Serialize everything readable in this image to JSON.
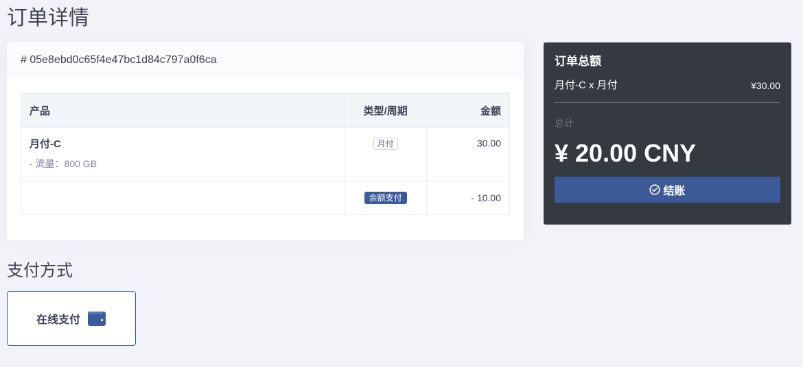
{
  "page_title": "订单详情",
  "order": {
    "id_label": "# 05e8ebd0c65f4e47bc1d84c797a0f6ca",
    "table": {
      "headers": [
        "产品",
        "类型/周期",
        "金额"
      ],
      "rows": [
        {
          "product_name": "月付-C",
          "product_detail": "- 流量：800 GB",
          "type_badge": "月付",
          "amount": "30.00"
        },
        {
          "product_name": "",
          "product_detail": "",
          "type_badge": "余额支付",
          "amount": "- 10.00"
        }
      ]
    }
  },
  "summary": {
    "title": "订单总额",
    "line_label": "月付-C x 月付",
    "line_price": "¥30.00",
    "total_label": "总计",
    "total_value": "¥ 20.00 CNY",
    "checkout_label": "结账",
    "checkout_icon": "check-circle-icon"
  },
  "payment": {
    "section_title": "支付方式",
    "options": [
      {
        "label": "在线支付",
        "icon": "wallet-icon"
      }
    ]
  },
  "colors": {
    "background": "#f2f3f8",
    "accent": "#3d5a98",
    "summary_bg": "#343a40",
    "text": "#3f4254"
  }
}
